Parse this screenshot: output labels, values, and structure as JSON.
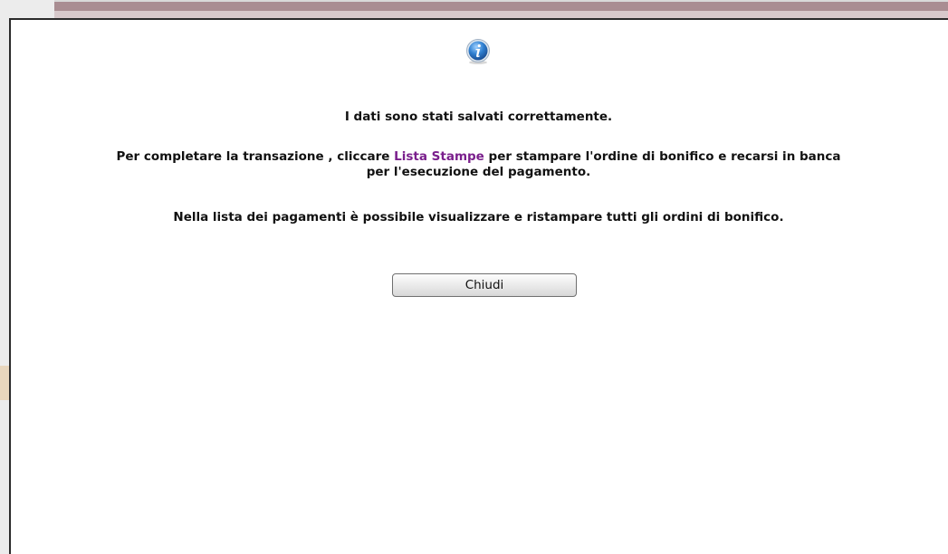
{
  "dialog": {
    "icon": "info-icon",
    "message_saved": "I dati sono stati salvati correttamente.",
    "message_complete_prefix": "Per completare la transazione , cliccare ",
    "message_complete_link": "Lista Stampe",
    "message_complete_suffix": " per stampare l'ordine di bonifico e recarsi in banca",
    "message_complete_line2": "per l'esecuzione del pagamento.",
    "message_list": "Nella lista dei pagamenti è possibile visualizzare e ristampare tutti gli ordini di bonifico.",
    "close_label": "Chiudi"
  },
  "colors": {
    "link": "#7a1f8c",
    "icon_blue": "#2f7fd0",
    "top_strip": "#a98d92"
  }
}
